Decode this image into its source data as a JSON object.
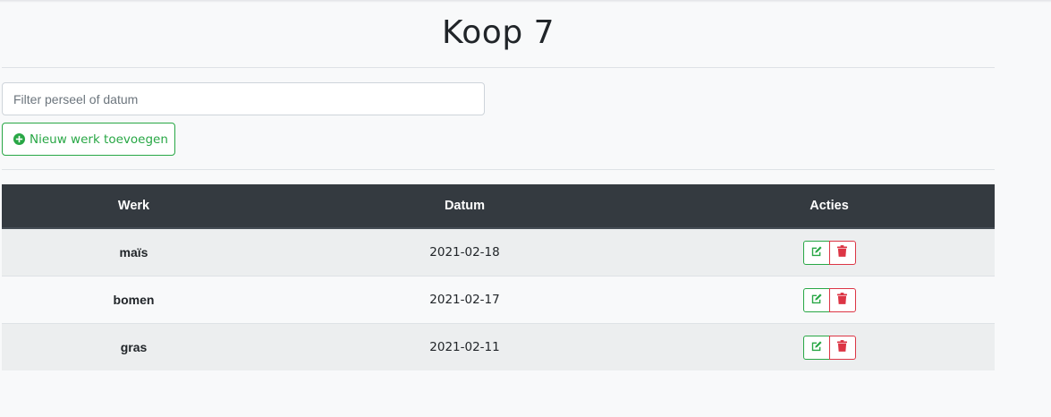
{
  "page": {
    "title": "Koop 7"
  },
  "filter": {
    "placeholder": "Filter perseel of datum",
    "value": ""
  },
  "add_button": {
    "label": "Nieuw werk toevoegen",
    "icon": "plus-circle-icon"
  },
  "table": {
    "headers": {
      "werk": "Werk",
      "datum": "Datum",
      "acties": "Acties"
    },
    "rows": [
      {
        "werk": "maïs",
        "datum": "2021-02-18"
      },
      {
        "werk": "bomen",
        "datum": "2021-02-17"
      },
      {
        "werk": "gras",
        "datum": "2021-02-11"
      }
    ],
    "row_actions": [
      "edit-icon",
      "trash-icon"
    ]
  },
  "colors": {
    "success": "#28a745",
    "danger": "#dc3545",
    "header_bg": "#343a40",
    "background": "#f8f9fa"
  }
}
